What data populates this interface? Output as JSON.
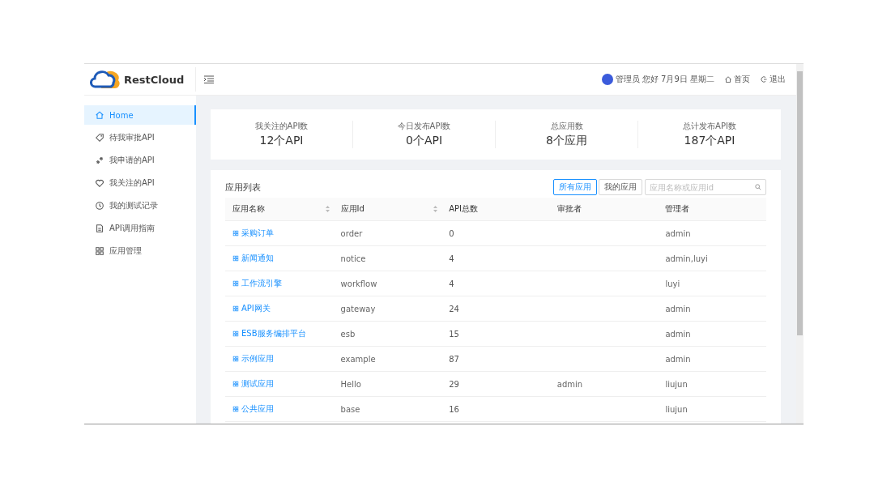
{
  "header": {
    "logo_text": "RestCloud",
    "greeting": "管理员 您好 7月9日 星期二",
    "links": [
      {
        "kind": "home",
        "label": "首页"
      },
      {
        "kind": "logout",
        "label": "退出"
      }
    ]
  },
  "sidebar": {
    "items": [
      {
        "label": "Home",
        "selected": true
      },
      {
        "label": "待我审批API",
        "selected": false
      },
      {
        "label": "我申请的API",
        "selected": false
      },
      {
        "label": "我关注的API",
        "selected": false
      },
      {
        "label": "我的测试记录",
        "selected": false
      },
      {
        "label": "API调用指南",
        "selected": false
      },
      {
        "label": "应用管理",
        "selected": false
      }
    ]
  },
  "stats": [
    {
      "label": "我关注的API数",
      "value": "12个API"
    },
    {
      "label": "今日发布API数",
      "value": "0个API"
    },
    {
      "label": "总应用数",
      "value": "8个应用"
    },
    {
      "label": "总计发布API数",
      "value": "187个API"
    }
  ],
  "app_list": {
    "title": "应用列表",
    "filters": [
      {
        "label": "所有应用",
        "selected": true
      },
      {
        "label": "我的应用",
        "selected": false
      }
    ],
    "search": {
      "placeholder": "应用名称或应用id"
    },
    "columns": [
      {
        "label": "应用名称",
        "sortable": true
      },
      {
        "label": "应用Id",
        "sortable": true
      },
      {
        "label": "API总数",
        "sortable": false
      },
      {
        "label": "审批者",
        "sortable": false
      },
      {
        "label": "管理者",
        "sortable": false
      }
    ],
    "rows": [
      {
        "name": "采购订单",
        "id": "order",
        "api_count": "0",
        "approver": "",
        "admin": "admin"
      },
      {
        "name": "新闻通知",
        "id": "notice",
        "api_count": "4",
        "approver": "",
        "admin": "admin,luyi"
      },
      {
        "name": "工作流引擎",
        "id": "workflow",
        "api_count": "4",
        "approver": "",
        "admin": "luyi"
      },
      {
        "name": "API网关",
        "id": "gateway",
        "api_count": "24",
        "approver": "",
        "admin": "admin"
      },
      {
        "name": "ESB服务编排平台",
        "id": "esb",
        "api_count": "15",
        "approver": "",
        "admin": "admin"
      },
      {
        "name": "示例应用",
        "id": "example",
        "api_count": "87",
        "approver": "",
        "admin": "admin"
      },
      {
        "name": "测试应用",
        "id": "Hello",
        "api_count": "29",
        "approver": "admin",
        "admin": "liujun"
      },
      {
        "name": "公共应用",
        "id": "base",
        "api_count": "16",
        "approver": "",
        "admin": "liujun"
      }
    ]
  }
}
